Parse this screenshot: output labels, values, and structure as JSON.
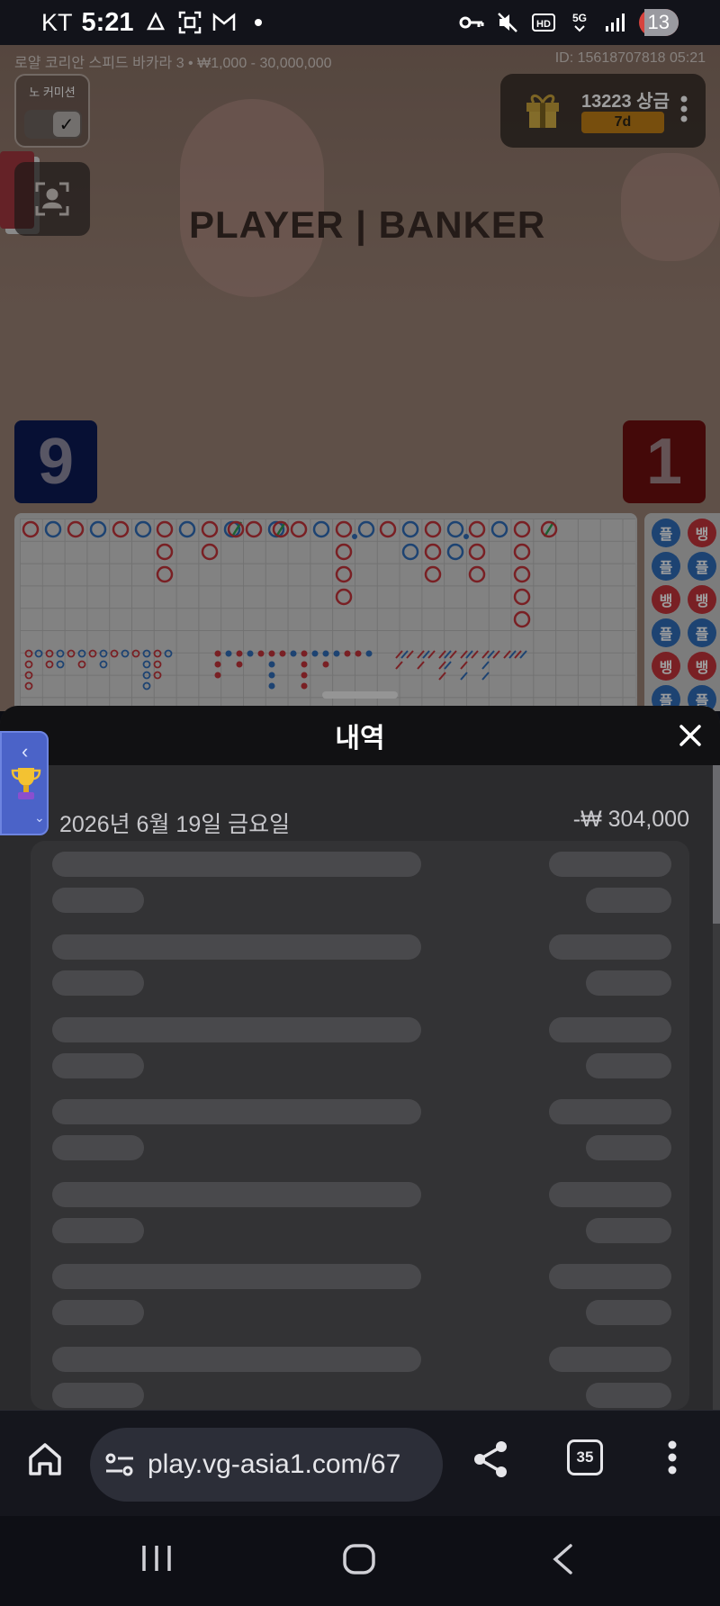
{
  "status_bar": {
    "carrier": "KT",
    "time": "5:21",
    "battery": "13"
  },
  "game": {
    "info": "로얄 코리안 스피드 바카라 3 • ₩1,000 - 30,000,000",
    "id_time": "ID: 15618707818 05:21",
    "no_commission_label": "노 커미션",
    "reward_count": "13223 상금",
    "reward_badge": "7d",
    "table_text": "PLAYER | BANKER",
    "player_score": "9",
    "banker_score": "1",
    "side_road": [
      "플",
      "뱅",
      "플",
      "플",
      "뱅",
      "뱅",
      "플",
      "플",
      "뱅",
      "뱅",
      "플",
      "플"
    ]
  },
  "history": {
    "title": "내역",
    "date": "2026년 6월 19일 금요일",
    "amount": "-₩ 304,000"
  },
  "browser": {
    "url": "play.vg-asia1.com/67",
    "tab_count": "35"
  },
  "icons": {
    "close": "close-icon",
    "home": "home-icon",
    "share": "share-icon",
    "more": "more-vert-icon",
    "trophy": "trophy-icon",
    "gift": "gift-icon"
  },
  "colors": {
    "player": "#2f6cb8",
    "banker": "#c4343b",
    "reward_badge": "#c17f15"
  }
}
